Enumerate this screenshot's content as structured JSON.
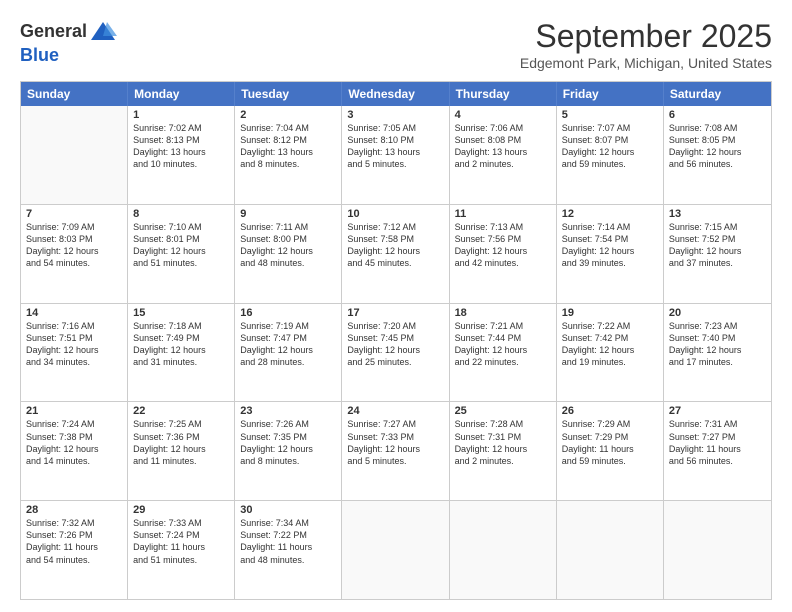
{
  "header": {
    "logo_general": "General",
    "logo_blue": "Blue",
    "month_title": "September 2025",
    "location": "Edgemont Park, Michigan, United States"
  },
  "days_of_week": [
    "Sunday",
    "Monday",
    "Tuesday",
    "Wednesday",
    "Thursday",
    "Friday",
    "Saturday"
  ],
  "weeks": [
    [
      {
        "day": "",
        "lines": []
      },
      {
        "day": "1",
        "lines": [
          "Sunrise: 7:02 AM",
          "Sunset: 8:13 PM",
          "Daylight: 13 hours",
          "and 10 minutes."
        ]
      },
      {
        "day": "2",
        "lines": [
          "Sunrise: 7:04 AM",
          "Sunset: 8:12 PM",
          "Daylight: 13 hours",
          "and 8 minutes."
        ]
      },
      {
        "day": "3",
        "lines": [
          "Sunrise: 7:05 AM",
          "Sunset: 8:10 PM",
          "Daylight: 13 hours",
          "and 5 minutes."
        ]
      },
      {
        "day": "4",
        "lines": [
          "Sunrise: 7:06 AM",
          "Sunset: 8:08 PM",
          "Daylight: 13 hours",
          "and 2 minutes."
        ]
      },
      {
        "day": "5",
        "lines": [
          "Sunrise: 7:07 AM",
          "Sunset: 8:07 PM",
          "Daylight: 12 hours",
          "and 59 minutes."
        ]
      },
      {
        "day": "6",
        "lines": [
          "Sunrise: 7:08 AM",
          "Sunset: 8:05 PM",
          "Daylight: 12 hours",
          "and 56 minutes."
        ]
      }
    ],
    [
      {
        "day": "7",
        "lines": [
          "Sunrise: 7:09 AM",
          "Sunset: 8:03 PM",
          "Daylight: 12 hours",
          "and 54 minutes."
        ]
      },
      {
        "day": "8",
        "lines": [
          "Sunrise: 7:10 AM",
          "Sunset: 8:01 PM",
          "Daylight: 12 hours",
          "and 51 minutes."
        ]
      },
      {
        "day": "9",
        "lines": [
          "Sunrise: 7:11 AM",
          "Sunset: 8:00 PM",
          "Daylight: 12 hours",
          "and 48 minutes."
        ]
      },
      {
        "day": "10",
        "lines": [
          "Sunrise: 7:12 AM",
          "Sunset: 7:58 PM",
          "Daylight: 12 hours",
          "and 45 minutes."
        ]
      },
      {
        "day": "11",
        "lines": [
          "Sunrise: 7:13 AM",
          "Sunset: 7:56 PM",
          "Daylight: 12 hours",
          "and 42 minutes."
        ]
      },
      {
        "day": "12",
        "lines": [
          "Sunrise: 7:14 AM",
          "Sunset: 7:54 PM",
          "Daylight: 12 hours",
          "and 39 minutes."
        ]
      },
      {
        "day": "13",
        "lines": [
          "Sunrise: 7:15 AM",
          "Sunset: 7:52 PM",
          "Daylight: 12 hours",
          "and 37 minutes."
        ]
      }
    ],
    [
      {
        "day": "14",
        "lines": [
          "Sunrise: 7:16 AM",
          "Sunset: 7:51 PM",
          "Daylight: 12 hours",
          "and 34 minutes."
        ]
      },
      {
        "day": "15",
        "lines": [
          "Sunrise: 7:18 AM",
          "Sunset: 7:49 PM",
          "Daylight: 12 hours",
          "and 31 minutes."
        ]
      },
      {
        "day": "16",
        "lines": [
          "Sunrise: 7:19 AM",
          "Sunset: 7:47 PM",
          "Daylight: 12 hours",
          "and 28 minutes."
        ]
      },
      {
        "day": "17",
        "lines": [
          "Sunrise: 7:20 AM",
          "Sunset: 7:45 PM",
          "Daylight: 12 hours",
          "and 25 minutes."
        ]
      },
      {
        "day": "18",
        "lines": [
          "Sunrise: 7:21 AM",
          "Sunset: 7:44 PM",
          "Daylight: 12 hours",
          "and 22 minutes."
        ]
      },
      {
        "day": "19",
        "lines": [
          "Sunrise: 7:22 AM",
          "Sunset: 7:42 PM",
          "Daylight: 12 hours",
          "and 19 minutes."
        ]
      },
      {
        "day": "20",
        "lines": [
          "Sunrise: 7:23 AM",
          "Sunset: 7:40 PM",
          "Daylight: 12 hours",
          "and 17 minutes."
        ]
      }
    ],
    [
      {
        "day": "21",
        "lines": [
          "Sunrise: 7:24 AM",
          "Sunset: 7:38 PM",
          "Daylight: 12 hours",
          "and 14 minutes."
        ]
      },
      {
        "day": "22",
        "lines": [
          "Sunrise: 7:25 AM",
          "Sunset: 7:36 PM",
          "Daylight: 12 hours",
          "and 11 minutes."
        ]
      },
      {
        "day": "23",
        "lines": [
          "Sunrise: 7:26 AM",
          "Sunset: 7:35 PM",
          "Daylight: 12 hours",
          "and 8 minutes."
        ]
      },
      {
        "day": "24",
        "lines": [
          "Sunrise: 7:27 AM",
          "Sunset: 7:33 PM",
          "Daylight: 12 hours",
          "and 5 minutes."
        ]
      },
      {
        "day": "25",
        "lines": [
          "Sunrise: 7:28 AM",
          "Sunset: 7:31 PM",
          "Daylight: 12 hours",
          "and 2 minutes."
        ]
      },
      {
        "day": "26",
        "lines": [
          "Sunrise: 7:29 AM",
          "Sunset: 7:29 PM",
          "Daylight: 11 hours",
          "and 59 minutes."
        ]
      },
      {
        "day": "27",
        "lines": [
          "Sunrise: 7:31 AM",
          "Sunset: 7:27 PM",
          "Daylight: 11 hours",
          "and 56 minutes."
        ]
      }
    ],
    [
      {
        "day": "28",
        "lines": [
          "Sunrise: 7:32 AM",
          "Sunset: 7:26 PM",
          "Daylight: 11 hours",
          "and 54 minutes."
        ]
      },
      {
        "day": "29",
        "lines": [
          "Sunrise: 7:33 AM",
          "Sunset: 7:24 PM",
          "Daylight: 11 hours",
          "and 51 minutes."
        ]
      },
      {
        "day": "30",
        "lines": [
          "Sunrise: 7:34 AM",
          "Sunset: 7:22 PM",
          "Daylight: 11 hours",
          "and 48 minutes."
        ]
      },
      {
        "day": "",
        "lines": []
      },
      {
        "day": "",
        "lines": []
      },
      {
        "day": "",
        "lines": []
      },
      {
        "day": "",
        "lines": []
      }
    ]
  ]
}
